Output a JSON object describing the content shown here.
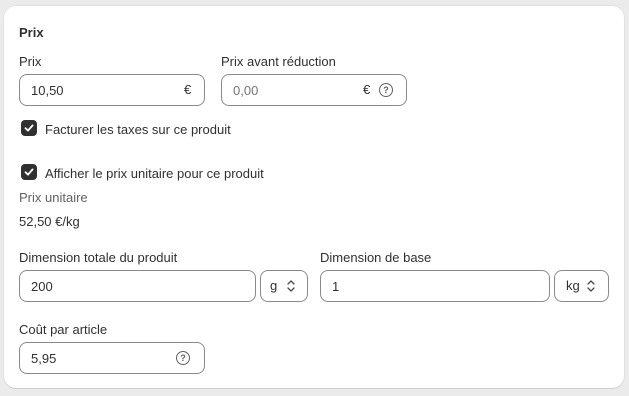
{
  "section": {
    "title": "Prix"
  },
  "price": {
    "label": "Prix",
    "value": "10,50",
    "currency": "€"
  },
  "compare_price": {
    "label": "Prix avant réduction",
    "placeholder": "0,00",
    "currency": "€"
  },
  "charge_tax": {
    "label": "Facturer les taxes sur ce produit",
    "checked": true
  },
  "unit_price": {
    "checkbox_label": "Afficher le prix unitaire pour ce produit",
    "checked": true,
    "heading": "Prix unitaire",
    "value": "52,50 €/kg"
  },
  "total_dimension": {
    "label": "Dimension totale du produit",
    "value": "200",
    "unit": "g"
  },
  "base_dimension": {
    "label": "Dimension de base",
    "value": "1",
    "unit": "kg"
  },
  "cost_per_item": {
    "label": "Coût par article",
    "value": "5,95"
  },
  "colors": {
    "checkbox": "#303030",
    "border": "#8a8a8a",
    "background": "#ebebeb"
  }
}
